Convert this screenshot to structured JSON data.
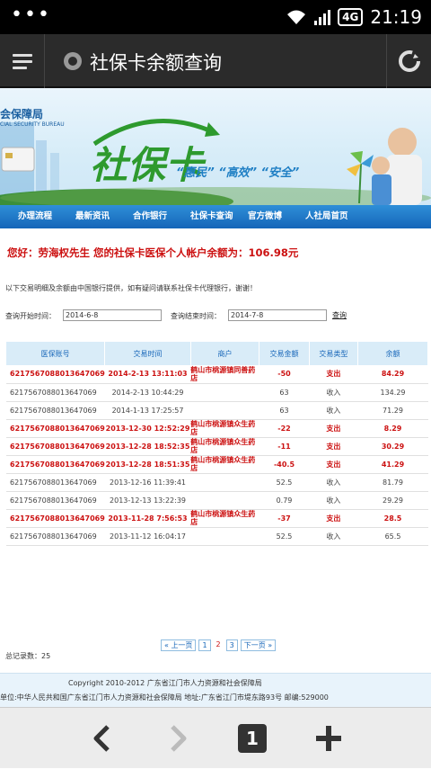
{
  "status_bar": {
    "network": "4G",
    "time": "21:19"
  },
  "browser": {
    "page_title": "社保卡余额查询"
  },
  "banner": {
    "logo_text": "会保障局",
    "logo_sub": "CIAL SECURITY BUREAU",
    "main_text": "社保卡",
    "slogan": "“惠民” “高效” “安全”"
  },
  "nav": {
    "items": [
      "办理流程",
      "最新资讯",
      "合作银行",
      "社保卡查询",
      "官方微博",
      "人社局首页"
    ]
  },
  "content": {
    "greeting": "您好：劳海权先生    您的社保卡医保个人帐户余额为：106.98元",
    "notice": "以下交易明细及余额由中国银行提供，如有疑问请联系社保卡代理银行，谢谢！",
    "query": {
      "start_label": "查询开始时间：",
      "start_value": "2014-6-8",
      "end_label": "查询结束时间：",
      "end_value": "2014-7-8",
      "button": "查询"
    },
    "table": {
      "headers": [
        "医保账号",
        "交易时间",
        "商户",
        "交易金额",
        "交易类型",
        "余额"
      ],
      "rows": [
        {
          "account": "6217567088013647069",
          "time": "2014-2-13 13:11:03",
          "merchant": "鹤山市桃源镇同善药店",
          "amount": "-50",
          "type": "支出",
          "balance": "84.29"
        },
        {
          "account": "6217567088013647069",
          "time": "2014-2-13 10:44:29",
          "merchant": "",
          "amount": "63",
          "type": "收入",
          "balance": "134.29"
        },
        {
          "account": "6217567088013647069",
          "time": "2014-1-13 17:25:57",
          "merchant": "",
          "amount": "63",
          "type": "收入",
          "balance": "71.29"
        },
        {
          "account": "6217567088013647069",
          "time": "2013-12-30 12:52:29",
          "merchant": "鹤山市桃源镇众生药店",
          "amount": "-22",
          "type": "支出",
          "balance": "8.29"
        },
        {
          "account": "6217567088013647069",
          "time": "2013-12-28 18:52:35",
          "merchant": "鹤山市桃源镇众生药店",
          "amount": "-11",
          "type": "支出",
          "balance": "30.29"
        },
        {
          "account": "6217567088013647069",
          "time": "2013-12-28 18:51:35",
          "merchant": "鹤山市桃源镇众生药店",
          "amount": "-40.5",
          "type": "支出",
          "balance": "41.29"
        },
        {
          "account": "6217567088013647069",
          "time": "2013-12-16 11:39:41",
          "merchant": "",
          "amount": "52.5",
          "type": "收入",
          "balance": "81.79"
        },
        {
          "account": "6217567088013647069",
          "time": "2013-12-13 13:22:39",
          "merchant": "",
          "amount": "0.79",
          "type": "收入",
          "balance": "29.29"
        },
        {
          "account": "6217567088013647069",
          "time": "2013-11-28 7:56:53",
          "merchant": "鹤山市桃源镇众生药店",
          "amount": "-37",
          "type": "支出",
          "balance": "28.5"
        },
        {
          "account": "6217567088013647069",
          "time": "2013-11-12 16:04:17",
          "merchant": "",
          "amount": "52.5",
          "type": "收入",
          "balance": "65.5"
        }
      ]
    },
    "pager": {
      "prev": "« 上一页",
      "pages": [
        "1",
        "2",
        "3"
      ],
      "current": "2",
      "next": "下一页 »"
    },
    "total": "总记录数：25"
  },
  "footer": {
    "line1": "Copyright 2010-2012 广东省江门市人力资源和社会保障局",
    "line2": "单位:中华人民共和国广东省江门市人力资源和社会保障局 地址:广东省江门市堤东路93号 邮编:529000"
  },
  "bottom_bar": {
    "tab_count": "1"
  },
  "colors": {
    "nav_blue": "#1565b8",
    "alert_red": "#cc1111",
    "banner_green": "#2e9a2e"
  }
}
